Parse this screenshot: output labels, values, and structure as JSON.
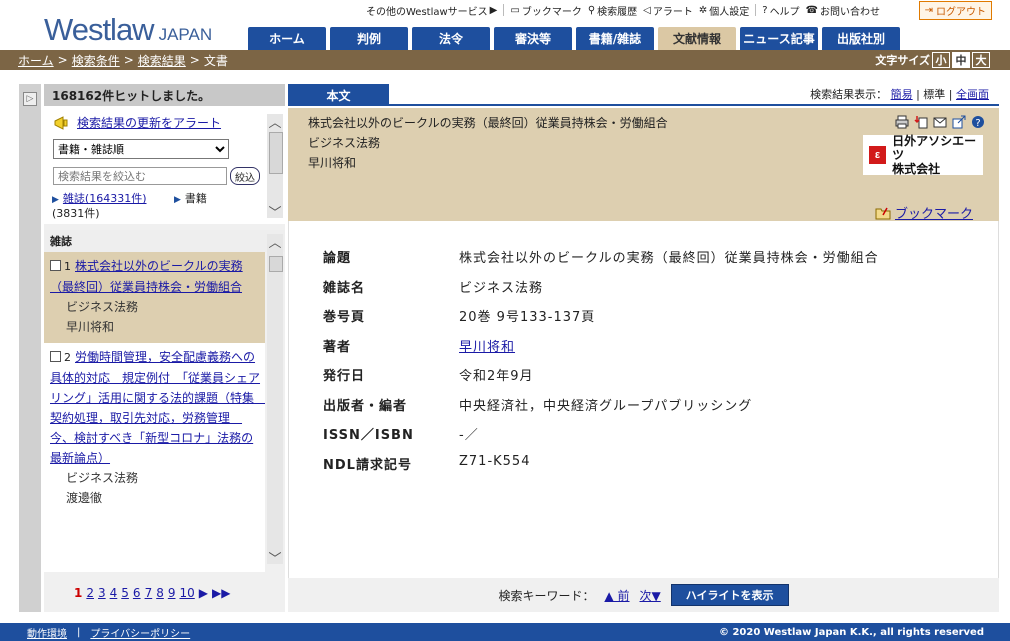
{
  "brand": {
    "logo_main": "Westlaw",
    "logo_sub": "JAPAN"
  },
  "util": {
    "other": "その他のWestlawサービス",
    "bookmark": "ブックマーク",
    "history": "検索履歴",
    "alert": "アラート",
    "settings": "個人設定",
    "help": "ヘルプ",
    "contact": "お問い合わせ",
    "logout": "ログアウト"
  },
  "nav": {
    "tabs": [
      {
        "label": "ホーム"
      },
      {
        "label": "判例"
      },
      {
        "label": "法令"
      },
      {
        "label": "審決等"
      },
      {
        "label": "書籍/雑誌"
      },
      {
        "label": "文献情報"
      },
      {
        "label": "ニュース記事"
      },
      {
        "label": "出版社別"
      }
    ],
    "active_index": 5
  },
  "breadcrumb": {
    "home": "ホーム",
    "cond": "検索条件",
    "result": "検索結果",
    "current": "文書",
    "sep": ">"
  },
  "fontsize": {
    "label": "文字サイズ",
    "small": "小",
    "mid": "中",
    "large": "大"
  },
  "left": {
    "hits": "168162件ヒットしました。",
    "alert_link": "検索結果の更新をアラート",
    "sort_option": "書籍・雑誌順",
    "narrow_placeholder": "検索結果を絞込む",
    "narrow_button": "絞込",
    "facet_magazine": "雑誌(164331件)",
    "facet_book": "書籍",
    "facet_book_count": "(3831件)",
    "section": "雑誌",
    "items": [
      {
        "num": "1",
        "title": "株式会社以外のビークルの実務（最終回）従業員持株会・労働組合",
        "pub": "ビジネス法務",
        "author": "早川将和"
      },
      {
        "num": "2",
        "title": "労働時間管理，安全配慮義務への具体的対応　規定例付　「従業員シェアリング」活用に関する法的課題（特集　契約処理，取引先対応，労務管理　今、検討すべき「新型コロナ」法務の最新論点）",
        "pub": "ビジネス法務",
        "author": "渡邊徹"
      }
    ],
    "pages": [
      "1",
      "2",
      "3",
      "4",
      "5",
      "6",
      "7",
      "8",
      "9",
      "10"
    ]
  },
  "right": {
    "tab": "本文",
    "display_label": "検索結果表示：",
    "display_simple": "簡易",
    "display_standard": "標準",
    "display_full": "全画面",
    "top_title": "株式会社以外のビークルの実務（最終回）従業員持株会・労働組合",
    "top_pub": "ビジネス法務",
    "top_author": "早川将和",
    "nichigai_line1": "日外アソシエーツ",
    "nichigai_line2": "株式会社",
    "bookmark": "ブックマーク",
    "fields": [
      {
        "k": "論題",
        "v": "株式会社以外のビークルの実務（最終回）従業員持株会・労働組合"
      },
      {
        "k": "雑誌名",
        "v": "ビジネス法務"
      },
      {
        "k": "巻号頁",
        "v": "20巻 9号133-137頁"
      },
      {
        "k": "著者",
        "v": "早川将和"
      },
      {
        "k": "発行日",
        "v": "令和2年9月"
      },
      {
        "k": "出版者・編者",
        "v": "中央経済社，中央経済グループパブリッシング"
      },
      {
        "k": "ISSN／ISBN",
        "v": "-／"
      },
      {
        "k": "NDL請求記号",
        "v": "Z71-K554"
      }
    ],
    "kw_label": "検索キーワード：",
    "kw_prev": "▲ 前",
    "kw_next": "次▼",
    "highlight": "ハイライトを表示"
  },
  "footer": {
    "env": "動作環境",
    "privacy": "プライバシーポリシー",
    "copyright": "© 2020 Westlaw Japan K.K., all rights reserved"
  },
  "colors": {
    "navy": "#1e4f9e",
    "brown": "#7c6545",
    "tan": "#ddcfb0"
  }
}
